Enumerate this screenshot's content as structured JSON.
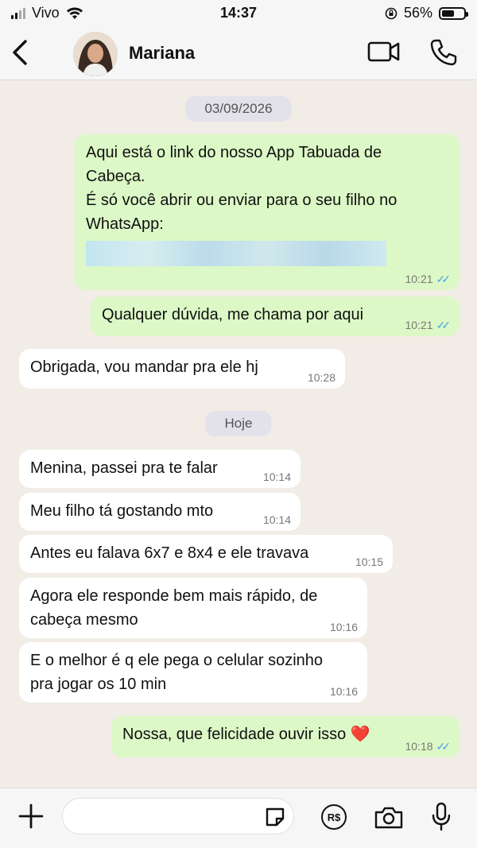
{
  "status_bar": {
    "carrier": "Vivo",
    "time": "14:37",
    "battery_percent": "56%",
    "battery_level": 0.56
  },
  "header": {
    "contact_name": "Mariana",
    "icons": [
      "back-chevron-icon",
      "video-call-icon",
      "phone-call-icon"
    ]
  },
  "chat": {
    "date_separators": [
      "03/09/2026",
      "Hoje"
    ],
    "messages": [
      {
        "direction": "out",
        "lines": [
          "Aqui está o link do nosso App Tabuada de",
          "Cabeça.",
          "É só você abrir ou enviar para o seu filho no",
          "WhatsApp:"
        ],
        "time": "10:21",
        "read": true
      },
      {
        "direction": "out",
        "text": "Qualquer dúvida, me chama por aqui",
        "time": "10:21",
        "read": true
      },
      {
        "direction": "in",
        "text": "Obrigada, vou mandar pra ele hj",
        "time": "10:28"
      },
      {
        "direction": "in",
        "text": "Menina, passei pra te falar",
        "time": "10:14"
      },
      {
        "direction": "in",
        "text": "Meu filho tá gostando mto",
        "time": "10:14"
      },
      {
        "direction": "in",
        "text": "Antes eu falava 6x7 e 8x4 e ele travava",
        "time": "10:15"
      },
      {
        "direction": "in",
        "lines": [
          "Agora ele responde bem mais rápido, de",
          "cabeça mesmo"
        ],
        "time": "10:16"
      },
      {
        "direction": "in",
        "lines": [
          "E o melhor é q ele pega o celular sozinho",
          "pra jogar os 10 min"
        ],
        "time": "10:16"
      },
      {
        "direction": "out",
        "text": "Nossa, que felicidade ouvir isso ❤️",
        "time": "10:18",
        "read": true
      }
    ]
  },
  "input_bar": {
    "placeholder": "",
    "icons": [
      "plus-icon",
      "sticker-icon",
      "payment-icon",
      "camera-icon",
      "microphone-icon"
    ],
    "payment_label": "R$"
  },
  "colors": {
    "chat_background": "#f1ede6",
    "outgoing_bubble": "#dcf8c6",
    "incoming_bubble": "#ffffff",
    "read_tick": "#4fa3e0"
  }
}
